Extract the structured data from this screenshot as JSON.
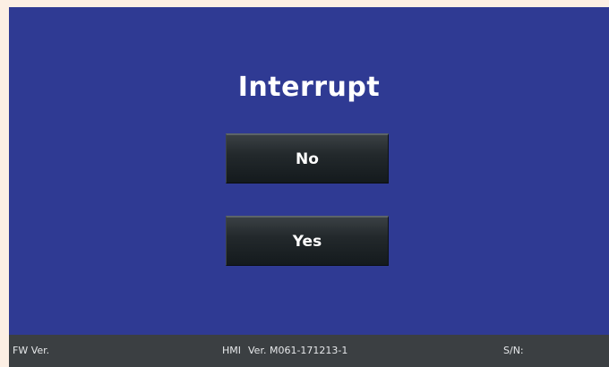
{
  "dialog": {
    "title": "Interrupt",
    "no_label": "No",
    "yes_label": "Yes"
  },
  "status_bar": {
    "fw_label": "FW Ver.",
    "hmi_label": "HMI",
    "hmi_version": "Ver. M061-171213-1",
    "sn_label": "S/N:"
  },
  "colors": {
    "screen_background": "#2f3a93",
    "button_background": "#1c2225",
    "status_bar_background": "#3b3f42",
    "outer_background": "#fcefe4"
  }
}
